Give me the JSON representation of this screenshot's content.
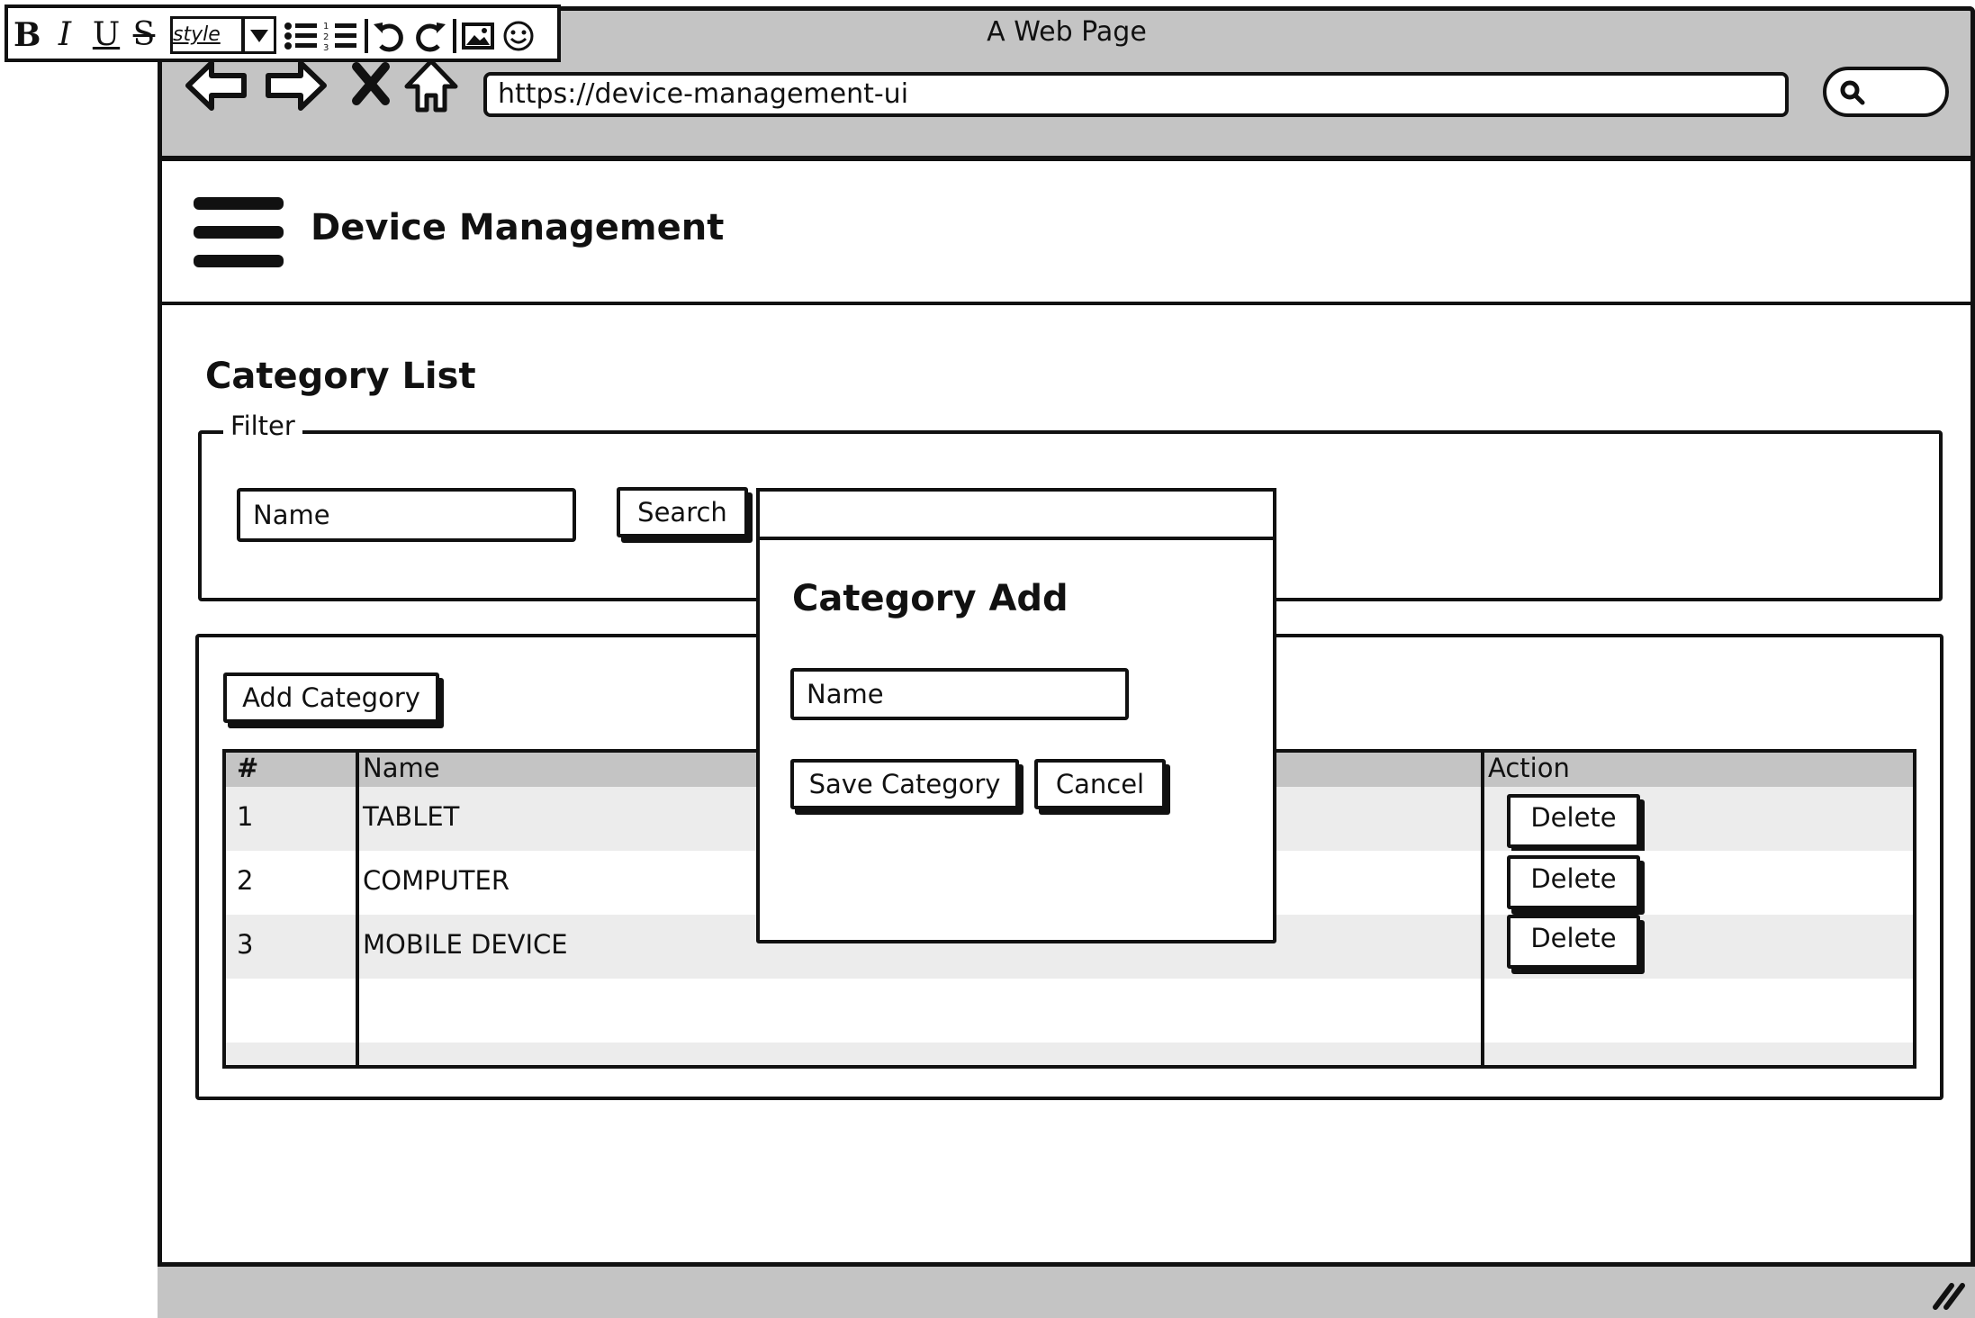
{
  "browser": {
    "window_title": "A Web Page",
    "url": "https://device-management-ui"
  },
  "toolbar": {
    "bold": "B",
    "italic": "I",
    "underline": "U",
    "strike": "S",
    "style": "style"
  },
  "header": {
    "app_title": "Device Management"
  },
  "page": {
    "title": "Category List",
    "filter_legend": "Filter",
    "filter_name_placeholder": "Name",
    "search_label": "Search",
    "add_category_label": "Add Category"
  },
  "table": {
    "columns": [
      "#",
      "Name",
      "Action"
    ],
    "rows": [
      {
        "num": "1",
        "name": "TABLET",
        "action": "Delete"
      },
      {
        "num": "2",
        "name": "COMPUTER",
        "action": "Delete"
      },
      {
        "num": "3",
        "name": "MOBILE DEVICE",
        "action": "Delete"
      }
    ]
  },
  "modal": {
    "title": "Category Add",
    "name_placeholder": "Name",
    "save_label": "Save Category",
    "cancel_label": "Cancel"
  },
  "colors": {
    "chrome_gray": "#c4c4c4",
    "row_stripe": "#ececec",
    "ink": "#111111"
  }
}
